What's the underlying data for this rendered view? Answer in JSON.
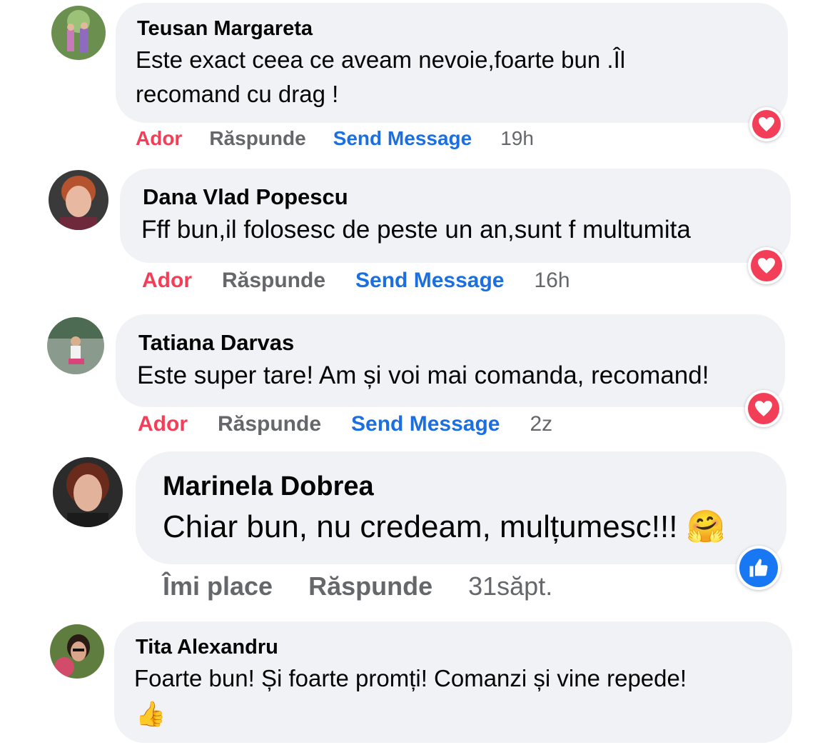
{
  "comments": [
    {
      "author": "Teusan Margareta",
      "text": "Este exact ceea ce aveam nevoie,foarte bun .Îl recomand cu drag !",
      "actions": {
        "react": "Ador",
        "reply": "Răspunde",
        "send": "Send Message",
        "time": "19h"
      },
      "reaction_icon": "heart-icon"
    },
    {
      "author": "Dana Vlad Popescu",
      "text": "Fff bun,il folosesc de peste un an,sunt f multumita",
      "actions": {
        "react": "Ador",
        "reply": "Răspunde",
        "send": "Send Message",
        "time": "16h"
      },
      "reaction_icon": "heart-icon"
    },
    {
      "author": "Tatiana Darvas",
      "text": "Este super tare! Am și voi mai comanda, recomand!",
      "actions": {
        "react": "Ador",
        "reply": "Răspunde",
        "send": "Send Message",
        "time": "2z"
      },
      "reaction_icon": "heart-icon"
    },
    {
      "author": "Marinela Dobrea",
      "text": "Chiar bun, nu credeam, mulțumesc!!! 🤗",
      "actions": {
        "react": "Îmi place",
        "reply": "Răspunde",
        "time": "31săpt."
      },
      "reaction_icon": "thumbs-up-icon"
    },
    {
      "author": "Tita Alexandru",
      "text": "Foarte bun! Și foarte promți! Comanzi și vine repede!",
      "emoji": "👍"
    }
  ],
  "colors": {
    "bubble_bg": "#f0f2f5",
    "love_red": "#f33e58",
    "link_blue": "#1b6fe0",
    "meta_gray": "#65676b",
    "like_blue": "#1877f2"
  }
}
